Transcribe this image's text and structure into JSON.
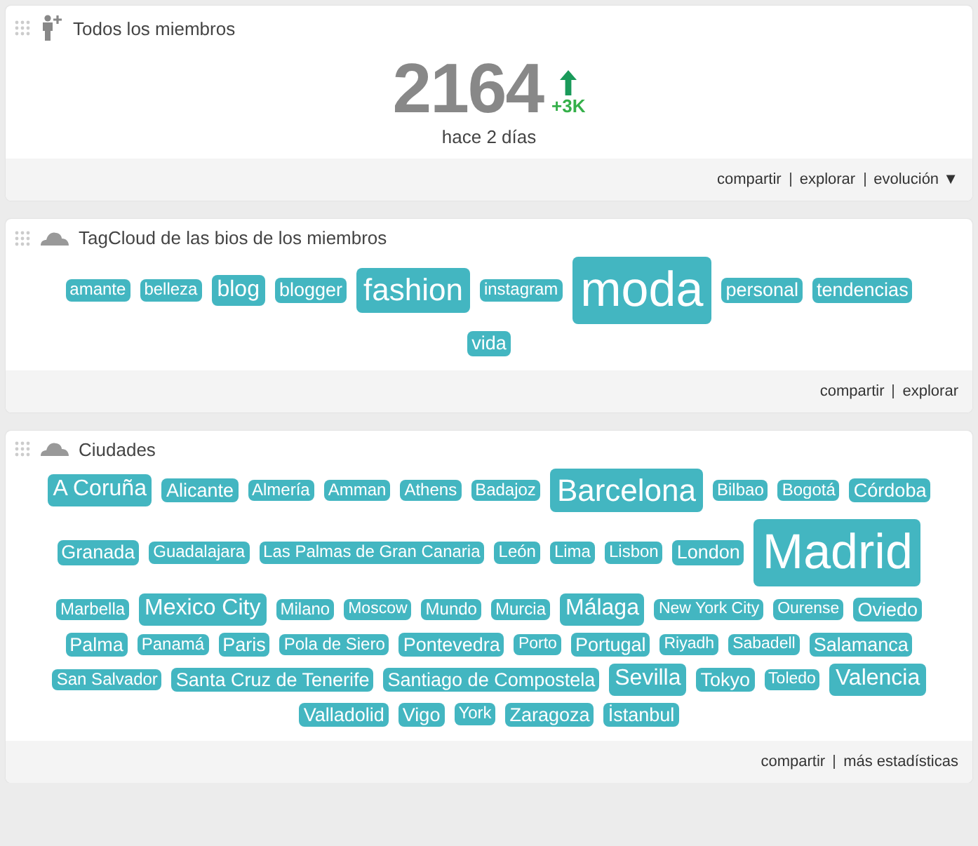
{
  "members": {
    "title": "Todos los miembros",
    "count": "2164",
    "delta": "+3K",
    "caption": "hace 2 días",
    "links": [
      "compartir",
      "explorar",
      "evolución ▼"
    ]
  },
  "bios": {
    "title": "TagCloud de las bios de los miembros",
    "tags": [
      {
        "label": "amante",
        "kind": "small"
      },
      {
        "label": "belleza",
        "kind": "small"
      },
      {
        "label": "blog",
        "kind": "large"
      },
      {
        "label": "blogger",
        "kind": "medium"
      },
      {
        "label": "fashion",
        "kind": "huge"
      },
      {
        "label": "instagram",
        "kind": "small"
      },
      {
        "label": "moda",
        "kind": "giant"
      },
      {
        "label": "personal",
        "kind": "medium"
      },
      {
        "label": "tendencias",
        "kind": "medium"
      },
      {
        "label": "vida",
        "kind": "medium"
      }
    ],
    "links": [
      "compartir",
      "explorar"
    ]
  },
  "cities": {
    "title": "Ciudades",
    "tags": [
      {
        "label": "A Coruña",
        "kind": "large"
      },
      {
        "label": "Alicante",
        "kind": "medium"
      },
      {
        "label": "Almería",
        "kind": "small"
      },
      {
        "label": "Amman",
        "kind": "small"
      },
      {
        "label": "Athens",
        "kind": "small"
      },
      {
        "label": "Badajoz",
        "kind": "small"
      },
      {
        "label": "Barcelona",
        "kind": "huge"
      },
      {
        "label": "Bilbao",
        "kind": "small"
      },
      {
        "label": "Bogotá",
        "kind": "small"
      },
      {
        "label": "Córdoba",
        "kind": "medium"
      },
      {
        "label": "Granada",
        "kind": "medium"
      },
      {
        "label": "Guadalajara",
        "kind": "small"
      },
      {
        "label": "Las Palmas de Gran Canaria",
        "kind": "small"
      },
      {
        "label": "León",
        "kind": "small"
      },
      {
        "label": "Lima",
        "kind": "small"
      },
      {
        "label": "Lisbon",
        "kind": "small"
      },
      {
        "label": "London",
        "kind": "medium"
      },
      {
        "label": "Madrid",
        "kind": "giant"
      },
      {
        "label": "Marbella",
        "kind": "small"
      },
      {
        "label": "Mexico City",
        "kind": "large"
      },
      {
        "label": "Milano",
        "kind": "small"
      },
      {
        "label": "Moscow",
        "kind": "tiny"
      },
      {
        "label": "Mundo",
        "kind": "small"
      },
      {
        "label": "Murcia",
        "kind": "small"
      },
      {
        "label": "Málaga",
        "kind": "large"
      },
      {
        "label": "New York City",
        "kind": "tiny"
      },
      {
        "label": "Ourense",
        "kind": "tiny"
      },
      {
        "label": "Oviedo",
        "kind": "medium"
      },
      {
        "label": "Palma",
        "kind": "medium"
      },
      {
        "label": "Panamá",
        "kind": "small"
      },
      {
        "label": "Paris",
        "kind": "medium"
      },
      {
        "label": "Pola de Siero",
        "kind": "small"
      },
      {
        "label": "Pontevedra",
        "kind": "medium"
      },
      {
        "label": "Porto",
        "kind": "tiny"
      },
      {
        "label": "Portugal",
        "kind": "medium"
      },
      {
        "label": "Riyadh",
        "kind": "tiny"
      },
      {
        "label": "Sabadell",
        "kind": "tiny"
      },
      {
        "label": "Salamanca",
        "kind": "medium"
      },
      {
        "label": "San Salvador",
        "kind": "small"
      },
      {
        "label": "Santa Cruz de Tenerife",
        "kind": "medium"
      },
      {
        "label": "Santiago de Compostela",
        "kind": "medium"
      },
      {
        "label": "Sevilla",
        "kind": "large"
      },
      {
        "label": "Tokyo",
        "kind": "medium"
      },
      {
        "label": "Toledo",
        "kind": "tiny"
      },
      {
        "label": "Valencia",
        "kind": "large"
      },
      {
        "label": "Valladolid",
        "kind": "medium"
      },
      {
        "label": "Vigo",
        "kind": "medium"
      },
      {
        "label": "York",
        "kind": "small"
      },
      {
        "label": "Zaragoza",
        "kind": "medium"
      },
      {
        "label": "İstanbul",
        "kind": "medium"
      }
    ],
    "links": [
      "compartir",
      "más estadísticas"
    ]
  }
}
